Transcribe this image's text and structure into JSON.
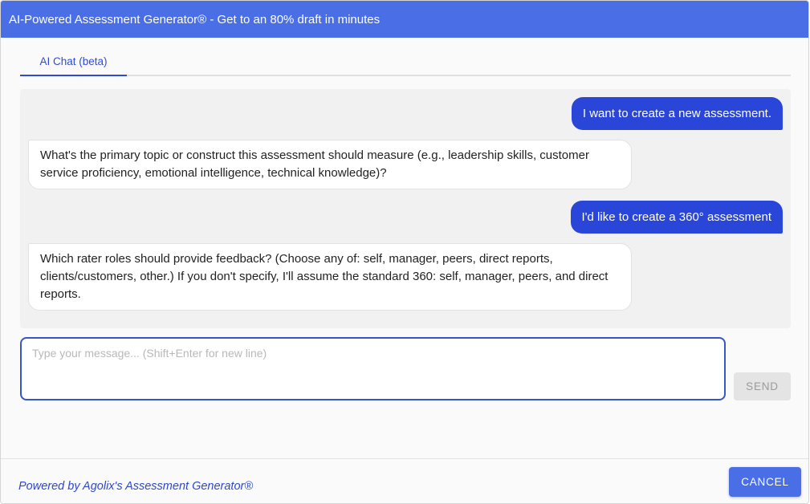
{
  "dialog": {
    "title": "AI-Powered Assessment Generator® - Get to an 80% draft in minutes"
  },
  "tabs": [
    {
      "label": "AI Chat (beta)",
      "active": true
    }
  ],
  "messages": [
    {
      "role": "user",
      "text": "I want to create a new assessment."
    },
    {
      "role": "assistant",
      "text": "What's the primary topic or construct this assessment should measure (e.g., leadership skills, customer service proficiency, emotional intelligence, technical knowledge)?"
    },
    {
      "role": "user",
      "text": "I'd like to create a 360° assessment"
    },
    {
      "role": "assistant",
      "text": "Which rater roles should provide feedback? (Choose any of: self, manager, peers, direct reports, clients/customers, other.) If you don't specify, I'll assume the standard 360: self, manager, peers, and direct reports."
    }
  ],
  "composer": {
    "placeholder": "Type your message... (Shift+Enter for new line)",
    "value": "",
    "send_label": "SEND",
    "send_enabled": false
  },
  "footer": {
    "powered_by": "Powered by Agolix's Assessment Generator®",
    "cancel_label": "CANCEL"
  },
  "colors": {
    "header": "#4a6ee6",
    "user_bubble": "#2a46d9",
    "accent": "#2f4bd6"
  }
}
